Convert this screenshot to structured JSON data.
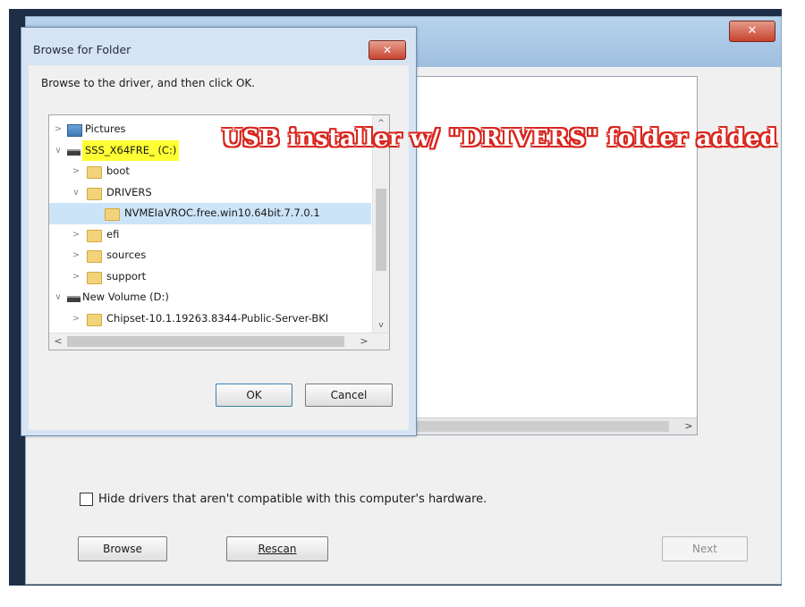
{
  "setup_window": {
    "close_glyph": "✕",
    "hide_drivers_label": "Hide drivers that aren't compatible with this computer's hardware.",
    "browse_button": "Browse",
    "rescan_button": "Rescan",
    "next_button": "Next",
    "scroll_right_glyph": ">"
  },
  "dialog": {
    "title": "Browse for Folder",
    "close_glyph": "✕",
    "instruction": "Browse to the driver, and then click OK.",
    "ok_button": "OK",
    "cancel_button": "Cancel",
    "tree": [
      {
        "label": "Pictures",
        "chevron": ">"
      },
      {
        "label": "SSS_X64FRE_ (C:)",
        "chevron": "∨"
      },
      {
        "label": "boot",
        "chevron": ">"
      },
      {
        "label": "DRIVERS",
        "chevron": "∨"
      },
      {
        "label": "NVMEIaVROC.free.win10.64bit.7.7.0.1",
        "chevron": ""
      },
      {
        "label": "efi",
        "chevron": ">"
      },
      {
        "label": "sources",
        "chevron": ">"
      },
      {
        "label": "support",
        "chevron": ">"
      },
      {
        "label": "New Volume (D:)",
        "chevron": "∨"
      },
      {
        "label": "Chipset-10.1.19263.8344-Public-Server-BKI",
        "chevron": ">"
      }
    ],
    "scroll_up_glyph": "^",
    "scroll_down_glyph": "v",
    "scroll_left_glyph": "<",
    "scroll_right_glyph": ">"
  },
  "annotation": {
    "text": "USB installer w/ \"DRIVERS\" folder added",
    "color": "#d8251d"
  },
  "colors": {
    "desktop": "#1e2e47",
    "highlight": "#ffff33",
    "selection": "#cce4f7"
  }
}
